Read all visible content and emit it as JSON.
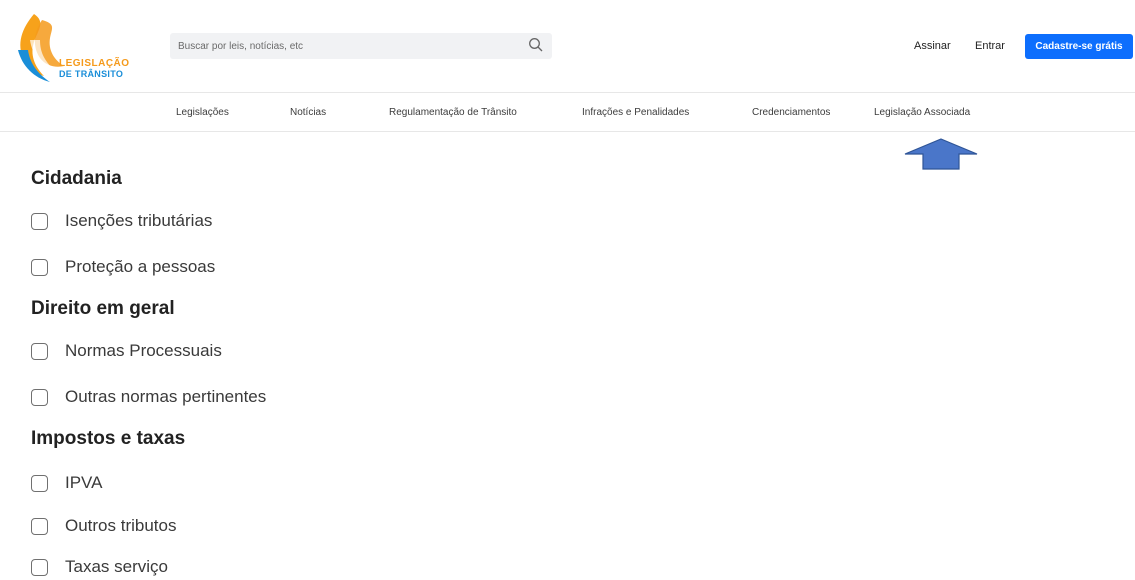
{
  "header": {
    "logo": {
      "line1": "LEGISLAÇÃO",
      "line2": "DE TRÂNSITO"
    },
    "search": {
      "placeholder": "Buscar por leis, notícias, etc",
      "icon": "search-icon"
    },
    "actions": {
      "subscribe": "Assinar",
      "login": "Entrar",
      "signup": "Cadastre-se grátis"
    },
    "accent_color": "#0d6efd"
  },
  "nav": {
    "items": [
      {
        "label": "Legislações"
      },
      {
        "label": "Notícias"
      },
      {
        "label": "Regulamentação de Trânsito"
      },
      {
        "label": "Infrações e Penalidades"
      },
      {
        "label": "Credenciamentos"
      },
      {
        "label": "Legislação Associada"
      }
    ]
  },
  "annotation": {
    "icon": "up-arrow-icon",
    "color": "#4a76c9"
  },
  "sections": [
    {
      "title": "Cidadania",
      "items": [
        "Isenções tributárias",
        "Proteção a pessoas"
      ]
    },
    {
      "title": "Direito em geral",
      "items": [
        "Normas Processuais",
        "Outras normas pertinentes"
      ]
    },
    {
      "title": "Impostos e taxas",
      "items": [
        "IPVA",
        "Outros tributos",
        "Taxas serviço"
      ]
    }
  ]
}
